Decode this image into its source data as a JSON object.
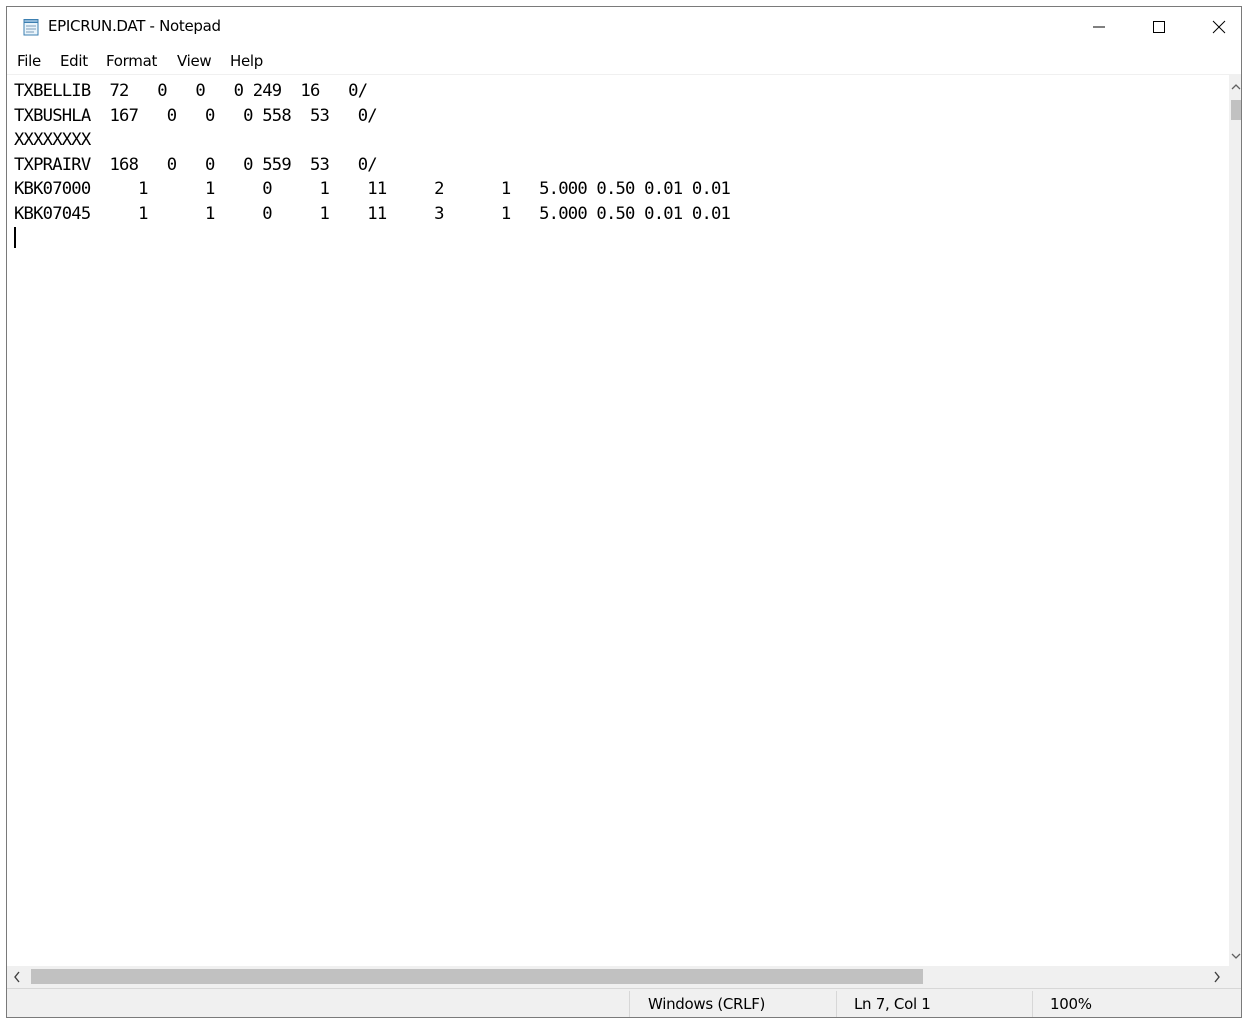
{
  "window": {
    "title": "EPICRUN.DAT - Notepad",
    "icon": "notepad-icon"
  },
  "caption_buttons": {
    "minimize": "minimize-icon",
    "maximize": "maximize-icon",
    "close": "close-icon"
  },
  "menu": {
    "file": "File",
    "edit": "Edit",
    "format": "Format",
    "view": "View",
    "help": "Help"
  },
  "editor": {
    "content": "TXBELLIB  72   0   0   0 249  16   0/\nTXBUSHLA  167   0   0   0 558  53   0/\nXXXXXXXX\nTXPRAIRV  168   0   0   0 559  53   0/\nKBK07000     1      1     0     1    11     2      1   5.000 0.50 0.01 0.01\nKBK07045     1      1     0     1    11     3      1   5.000 0.50 0.01 0.01\n",
    "caret_line": 7
  },
  "scrollbars": {
    "up_arrow": "chevron-up-icon",
    "down_arrow": "chevron-down-icon",
    "left_arrow": "chevron-left-icon",
    "right_arrow": "chevron-right-icon"
  },
  "status": {
    "line_ending": "Windows (CRLF)",
    "position": "Ln 7, Col 1",
    "zoom": "100%"
  },
  "colors": {
    "chrome_background": "#f0f0f0",
    "scroll_thumb": "#c1c1c1",
    "text": "#000000"
  }
}
